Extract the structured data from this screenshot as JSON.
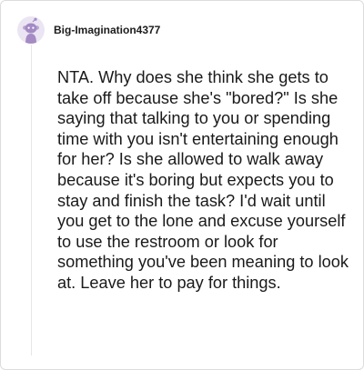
{
  "comment": {
    "username": "Big-Imagination4377",
    "avatar_icon": "snoo-avatar-icon",
    "body": "NTA. Why does she think she gets to take off because she's \"bored?\" Is she saying that talking to you or spending time with you isn't entertaining enough for her? Is she allowed to walk away because it's boring but expects you to stay and finish the task? I'd wait until you get to the lone and excuse yourself to use the restroom or look for something you've been meaning to look at. Leave her to pay for things."
  },
  "colors": {
    "avatar_background": "#ebe5f3",
    "avatar_figure": "#a48bc4",
    "text": "#1a1a1b",
    "border": "#dcdcdc"
  }
}
